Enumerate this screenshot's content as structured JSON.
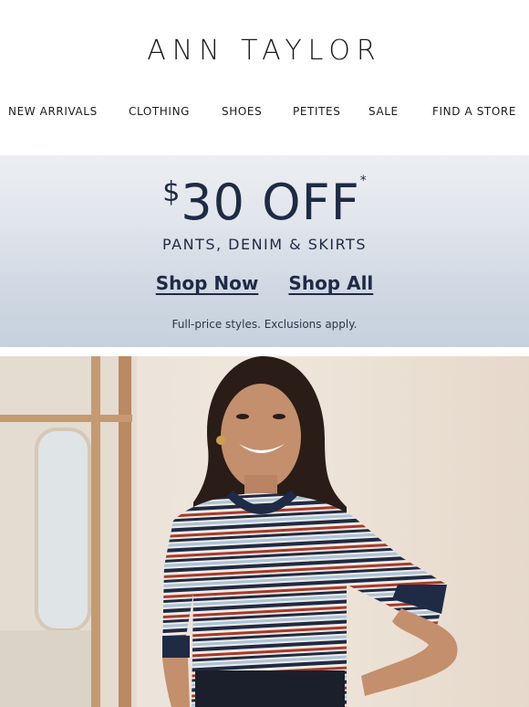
{
  "brand": {
    "logo_text": "ANN TAYLOR"
  },
  "nav": {
    "items": [
      {
        "label": "NEW ARRIVALS"
      },
      {
        "label": "CLOTHING"
      },
      {
        "label": "SHOES"
      },
      {
        "label": "PETITES"
      },
      {
        "label": "SALE"
      },
      {
        "label": "FIND A STORE"
      }
    ]
  },
  "promo": {
    "currency": "$",
    "amount": "30 OFF",
    "asterisk": "*",
    "subheading": "PANTS, DENIM & SKIRTS",
    "cta_primary": "Shop Now",
    "cta_secondary": "Shop All",
    "fine_print": "Full-price styles. Exclusions apply."
  },
  "hero": {
    "image_icon": "model-photo"
  },
  "colors": {
    "navy": "#1f2a44",
    "promo_top": "#eceef1",
    "promo_bottom": "#c6d1dd",
    "stripe_red": "#a8382c",
    "stripe_blue": "#a9c3dc"
  }
}
